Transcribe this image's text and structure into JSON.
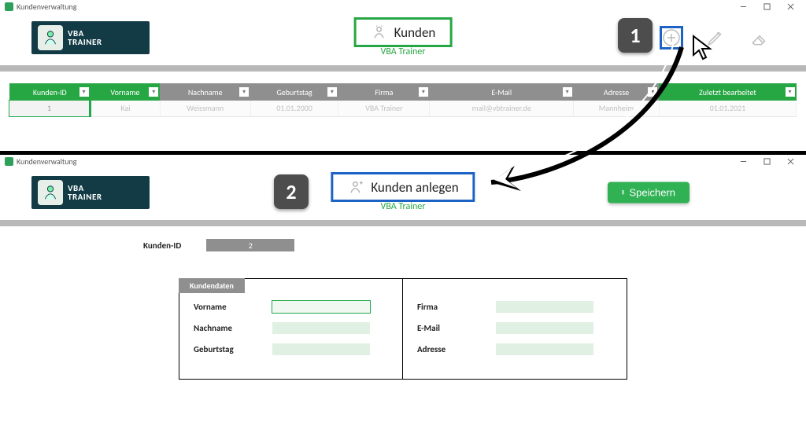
{
  "colors": {
    "green": "#27a744",
    "blue": "#1d63c5",
    "dark": "#123b46",
    "gray": "#8f8f8f"
  },
  "window": {
    "app_title": "Kundenverwaltung",
    "brand_line1": "VBA",
    "brand_line2": "TRAINER",
    "footer_brand": "VBA Trainer"
  },
  "tutorial": {
    "step1": "1",
    "step2": "2"
  },
  "actions": {
    "add_icon": "add-circle",
    "edit_icon": "pencil",
    "delete_icon": "eraser",
    "save_label": "Speichern"
  },
  "top_view": {
    "title": "Kunden",
    "columns": [
      {
        "key": "id",
        "label": "Kunden-ID",
        "accent": "green"
      },
      {
        "key": "vorname",
        "label": "Vorname",
        "accent": "green"
      },
      {
        "key": "nachname",
        "label": "Nachname",
        "accent": "gray"
      },
      {
        "key": "geb",
        "label": "Geburtstag",
        "accent": "gray"
      },
      {
        "key": "firma",
        "label": "Firma",
        "accent": "gray"
      },
      {
        "key": "email",
        "label": "E-Mail",
        "accent": "gray"
      },
      {
        "key": "adresse",
        "label": "Adresse",
        "accent": "gray"
      },
      {
        "key": "edit",
        "label": "Zuletzt bearbeitet",
        "accent": "green"
      }
    ],
    "rows": [
      {
        "id": "1",
        "vorname": "Kai",
        "nachname": "Weissmann",
        "geb": "01.01.2000",
        "firma": "VBA Trainer",
        "email": "mail@vbtrainer.de",
        "adresse": "Mannheim",
        "edit": "01.01.2021"
      }
    ]
  },
  "bottom_view": {
    "title": "Kunden anlegen",
    "id_label": "Kunden-ID",
    "id_value": "2",
    "panel_tab": "Kundendaten",
    "left_fields": [
      {
        "label": "Vorname"
      },
      {
        "label": "Nachname"
      },
      {
        "label": "Geburtstag"
      }
    ],
    "right_fields": [
      {
        "label": "Firma"
      },
      {
        "label": "E-Mail"
      },
      {
        "label": "Adresse"
      }
    ]
  }
}
